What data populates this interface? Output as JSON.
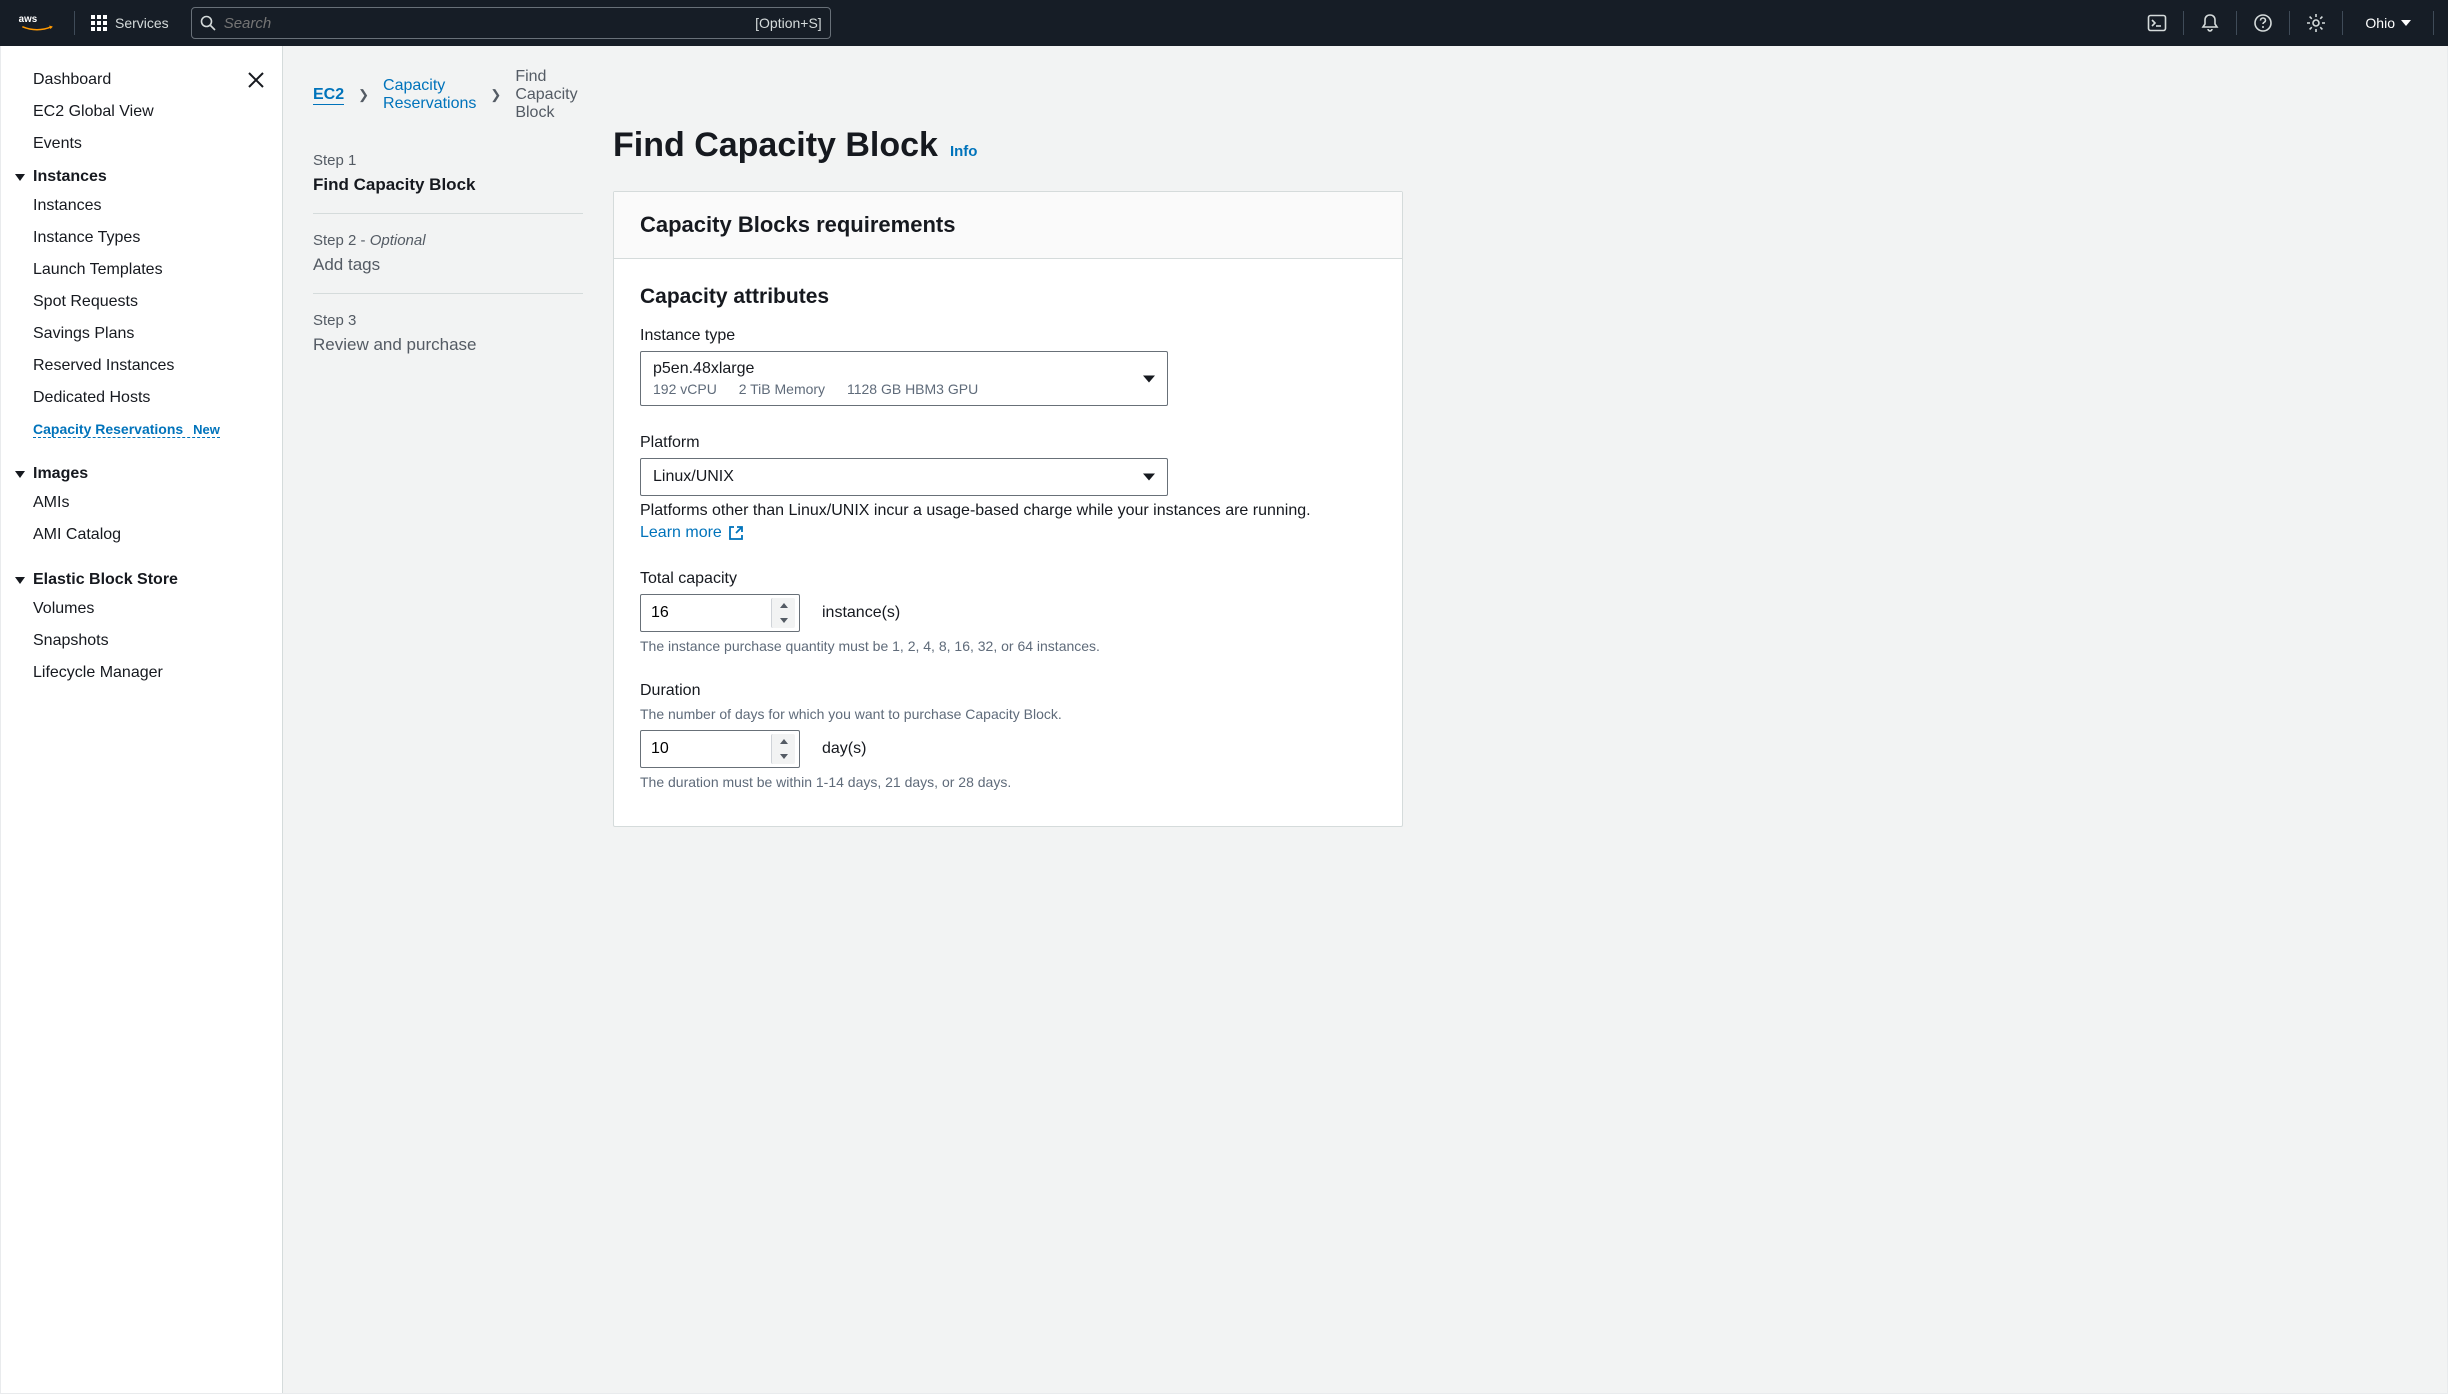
{
  "topnav": {
    "services_label": "Services",
    "search_placeholder": "Search",
    "search_hint": "[Option+S]",
    "region": "Ohio"
  },
  "sidebar": {
    "top": [
      {
        "label": "Dashboard"
      },
      {
        "label": "EC2 Global View"
      },
      {
        "label": "Events"
      }
    ],
    "sections": [
      {
        "title": "Instances",
        "items": [
          "Instances",
          "Instance Types",
          "Launch Templates",
          "Spot Requests",
          "Savings Plans",
          "Reserved Instances",
          "Dedicated Hosts"
        ],
        "active_item": "Capacity Reservations",
        "active_badge": "New"
      },
      {
        "title": "Images",
        "items": [
          "AMIs",
          "AMI Catalog"
        ]
      },
      {
        "title": "Elastic Block Store",
        "items": [
          "Volumes",
          "Snapshots",
          "Lifecycle Manager"
        ]
      }
    ]
  },
  "breadcrumb": {
    "root": "EC2",
    "parent": "Capacity Reservations",
    "current": "Find Capacity Block"
  },
  "steps": {
    "s1_label": "Step 1",
    "s1_title": "Find Capacity Block",
    "s2_label": "Step 2 - ",
    "s2_optional": "Optional",
    "s2_title": "Add tags",
    "s3_label": "Step 3",
    "s3_title": "Review and purchase"
  },
  "page": {
    "title": "Find Capacity Block",
    "info": "Info",
    "panel_title": "Capacity Blocks requirements",
    "section_title": "Capacity attributes",
    "instance_type_label": "Instance type",
    "instance_type": {
      "value": "p5en.48xlarge",
      "vcpu": "192 vCPU",
      "mem": "2 TiB Memory",
      "gpu": "1128 GB HBM3 GPU"
    },
    "platform_label": "Platform",
    "platform_value": "Linux/UNIX",
    "platform_help": "Platforms other than Linux/UNIX incur a usage-based charge while your instances are running.",
    "learn_more": "Learn more",
    "capacity_label": "Total capacity",
    "capacity_value": "16",
    "capacity_unit": "instance(s)",
    "capacity_help": "The instance purchase quantity must be 1, 2, 4, 8, 16, 32, or 64 instances.",
    "duration_label": "Duration",
    "duration_desc": "The number of days for which you want to purchase Capacity Block.",
    "duration_value": "10",
    "duration_unit": "day(s)",
    "duration_help": "The duration must be within 1-14 days, 21 days, or 28 days."
  }
}
